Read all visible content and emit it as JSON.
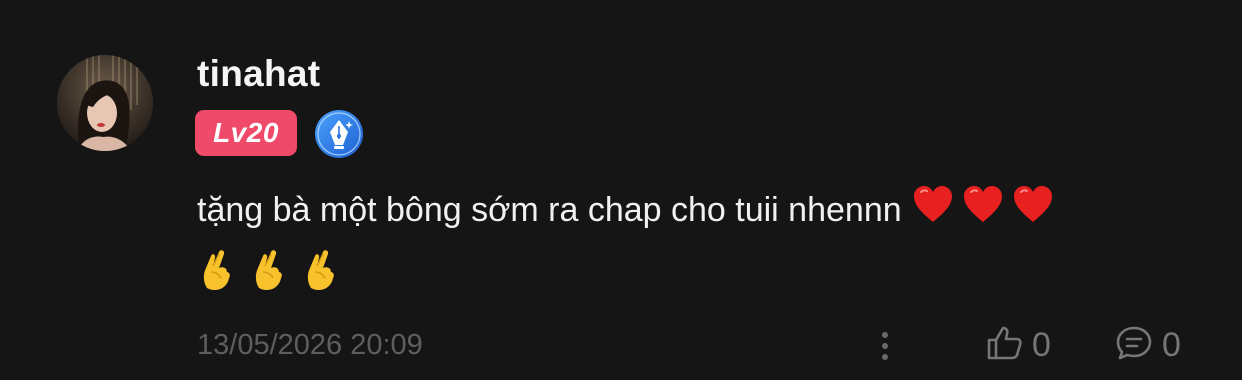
{
  "comment": {
    "username": "tinahat",
    "level_badge": "Lv20",
    "badge_icon": "fountain-pen-icon",
    "text": "tặng bà một bông sớm ra chap cho tuii nhennn",
    "line1_emojis": [
      "red-heart-icon",
      "red-heart-icon",
      "red-heart-icon"
    ],
    "line2_emojis": [
      "crossed-fingers-icon",
      "crossed-fingers-icon",
      "crossed-fingers-icon"
    ],
    "timestamp": "13/05/2026 20:09",
    "like_count": "0",
    "reply_count": "0"
  },
  "colors": {
    "background": "#151515",
    "level_badge": "#ef4a6a",
    "writer_badge": "#2f7ee6",
    "muted": "#5e5e5e"
  }
}
